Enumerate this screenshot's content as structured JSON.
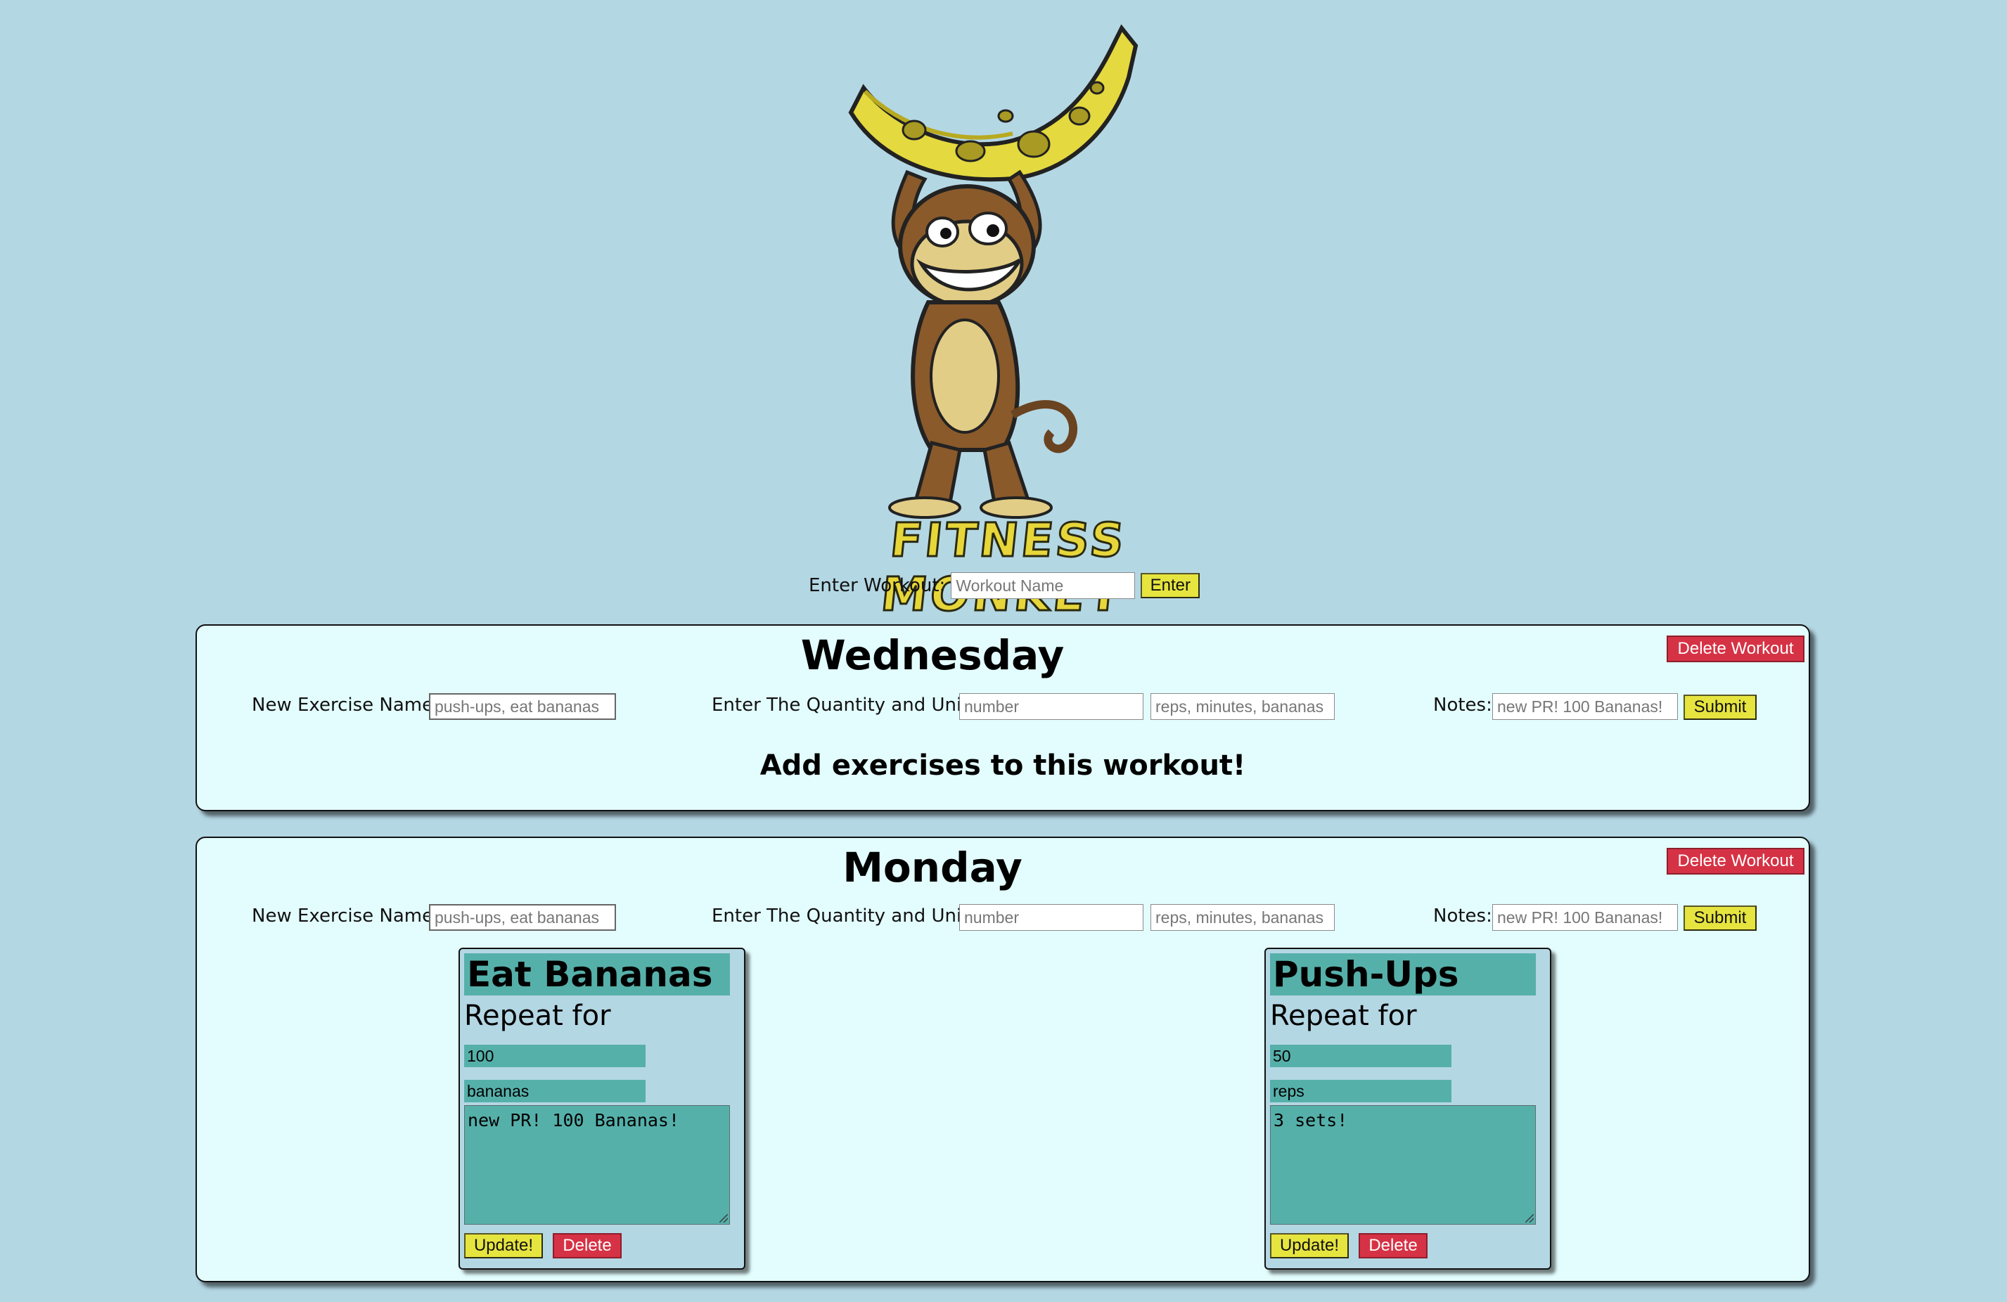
{
  "header": {
    "brand": "FITNESS MONKEY",
    "logo_icon": "monkey-holding-banana-logo",
    "enter_workout_label": "Enter Workout:",
    "workout_name_placeholder": "Workout Name",
    "enter_button": "Enter"
  },
  "form_labels": {
    "exercise_name": "New Exercise Name:",
    "exercise_placeholder": "push-ups, eat bananas",
    "quantity_units": "Enter The Quantity and Units",
    "number_placeholder": "number",
    "units_placeholder": "reps, minutes, bananas",
    "notes": "Notes:",
    "notes_placeholder": "new PR! 100 Bananas!",
    "submit": "Submit",
    "delete_workout": "Delete Workout",
    "empty_message": "Add exercises to this workout!",
    "repeat_for": "Repeat for",
    "update": "Update!",
    "delete": "Delete"
  },
  "workouts": [
    {
      "title": "Wednesday",
      "exercises": []
    },
    {
      "title": "Monday",
      "exercises": [
        {
          "name": "Eat Bananas",
          "quantity": "100",
          "units": "bananas",
          "notes": "new PR! 100 Bananas!"
        },
        {
          "name": "Push-Ups",
          "quantity": "50",
          "units": "reps",
          "notes": "3 sets!"
        }
      ]
    }
  ],
  "colors": {
    "background": "#b4d7e4",
    "panel": "#e3fdfe",
    "card_field": "#56b0aa",
    "button_yellow": "#e6e43f",
    "button_red": "#d63245"
  }
}
